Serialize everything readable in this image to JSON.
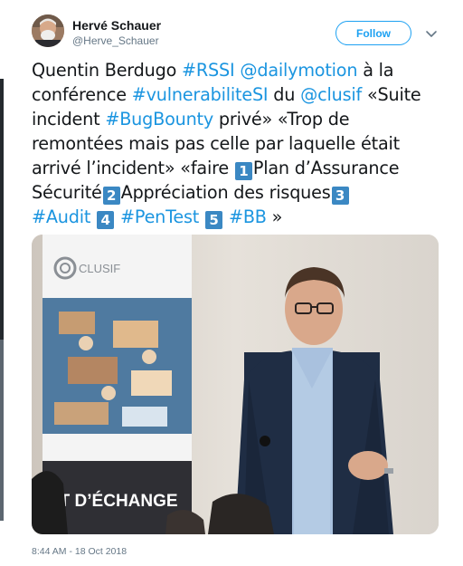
{
  "author": {
    "name": "Hervé Schauer",
    "handle": "@Herve_Schauer"
  },
  "follow_label": "Follow",
  "tweet": {
    "lines": [
      [
        {
          "t": "Quentin Berdugo "
        },
        {
          "t": "#RSSI",
          "link": true
        },
        {
          "t": " "
        },
        {
          "t": "@dailymotion",
          "link": true
        },
        {
          "t": "  à la"
        }
      ],
      [
        {
          "t": "conférence "
        },
        {
          "t": "#vulnerabiliteSI",
          "link": true
        },
        {
          "t": " du "
        },
        {
          "t": "@clusif",
          "link": true
        },
        {
          "t": " «Suite"
        }
      ],
      [
        {
          "t": "incident "
        },
        {
          "t": "#BugBounty",
          "link": true
        },
        {
          "t": " privé» «Trop de"
        }
      ],
      [
        {
          "t": "remontées  mais pas celle par laquelle était"
        }
      ],
      [
        {
          "t": "arrivé l’incident» «faire "
        },
        {
          "k": "1"
        },
        {
          "t": "Plan d’Assurance"
        }
      ],
      [
        {
          "t": "Sécurité"
        },
        {
          "k": "2"
        },
        {
          "t": "Appréciation des risques"
        },
        {
          "k": "3"
        }
      ],
      [
        {
          "t": "#Audit",
          "link": true
        },
        {
          "t": " "
        },
        {
          "k": "4"
        },
        {
          "t": " "
        },
        {
          "t": "#PenTest",
          "link": true
        },
        {
          "t": " "
        },
        {
          "k": "5"
        },
        {
          "t": " "
        },
        {
          "t": "#BB",
          "link": true
        },
        {
          "t": " »"
        }
      ]
    ]
  },
  "photo": {
    "banner_brand": "CLUSIF",
    "banner_caption": "ET D’ÉCHANGE"
  },
  "timestamp": "8:44 AM - 18 Oct 2018",
  "colors": {
    "link": "#1b95e0",
    "follow": "#1da1f2",
    "keycap": "#3b88c3",
    "muted": "#657786"
  }
}
